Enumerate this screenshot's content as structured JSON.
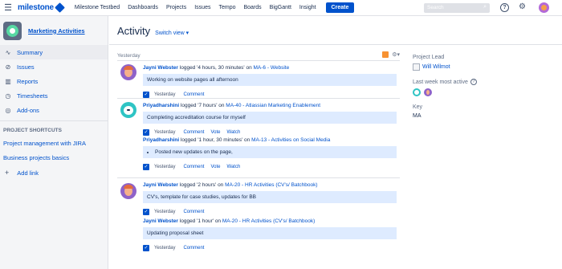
{
  "topnav": {
    "logo_text": "milestone",
    "logo_sub": "SOLUTIONS",
    "items": [
      "Milestone Testbed",
      "Dashboards",
      "Projects",
      "Issues",
      "Tempo",
      "Boards",
      "BigGantt",
      "Insight"
    ],
    "create_label": "Create",
    "search_placeholder": "Search",
    "help_glyph": "?"
  },
  "sidebar": {
    "project_name": "Marketing Activities",
    "items": [
      {
        "label": "Summary",
        "icon": "pulse-icon"
      },
      {
        "label": "Issues",
        "icon": "issues-icon"
      },
      {
        "label": "Reports",
        "icon": "reports-icon"
      },
      {
        "label": "Timesheets",
        "icon": "timesheets-icon"
      },
      {
        "label": "Add-ons",
        "icon": "addons-icon"
      }
    ],
    "section_title": "PROJECT SHORTCUTS",
    "shortcuts": [
      "Project management with JIRA",
      "Business projects basics"
    ],
    "add_link_label": "Add link"
  },
  "main": {
    "title": "Activity",
    "switch_view": "Switch view ▾",
    "day_label": "Yesterday",
    "entries": [
      {
        "avatar": "purple",
        "items": [
          {
            "user": "Jayni Webster",
            "verb": " logged '4 hours, 30 minutes' on ",
            "issue": "MA-6 - Website",
            "comment": "Working on website pages all afternoon",
            "time": "Yesterday",
            "actions": [
              "Comment"
            ]
          }
        ]
      },
      {
        "avatar": "teal",
        "items": [
          {
            "user": "Priyadharshini",
            "verb": " logged '7 hours' on ",
            "issue": "MA-40 - Atlassian Marketing Enablement",
            "comment": "Completing accreditation course for myself",
            "time": "Yesterday",
            "actions": [
              "Comment",
              "Vote",
              "Watch"
            ]
          },
          {
            "user": "Priyadharshini",
            "verb": " logged '1 hour, 30 minutes' on ",
            "issue": "MA-13 - Activities on Social Media",
            "comment": "Posted new updates on the page,",
            "time": "Yesterday",
            "actions": [
              "Comment",
              "Vote",
              "Watch"
            ]
          }
        ]
      },
      {
        "avatar": "purple",
        "items": [
          {
            "user": "Jayni Webster",
            "verb": " logged '2 hours' on ",
            "issue": "MA-20 - HR Activities (CV's/ Batchbook)",
            "comment": "CV's, template for case studies, updates for BB",
            "time": "Yesterday",
            "actions": [
              "Comment"
            ]
          },
          {
            "user": "Jayni Webster",
            "verb": " logged '1 hour' on ",
            "issue": "MA-20 - HR Activities (CV's/ Batchbook)",
            "comment": "Updating proposal sheet",
            "time": "Yesterday",
            "actions": [
              "Comment"
            ]
          }
        ]
      }
    ]
  },
  "rpanel": {
    "lead_label": "Project Lead",
    "lead_name": "Will Wilmot",
    "active_label": "Last week most active",
    "key_label": "Key",
    "key_value": "MA"
  },
  "colors": {
    "brand": "#0052cc",
    "comment_bg": "#deebff",
    "sidebar_bg": "#f4f5f7"
  }
}
